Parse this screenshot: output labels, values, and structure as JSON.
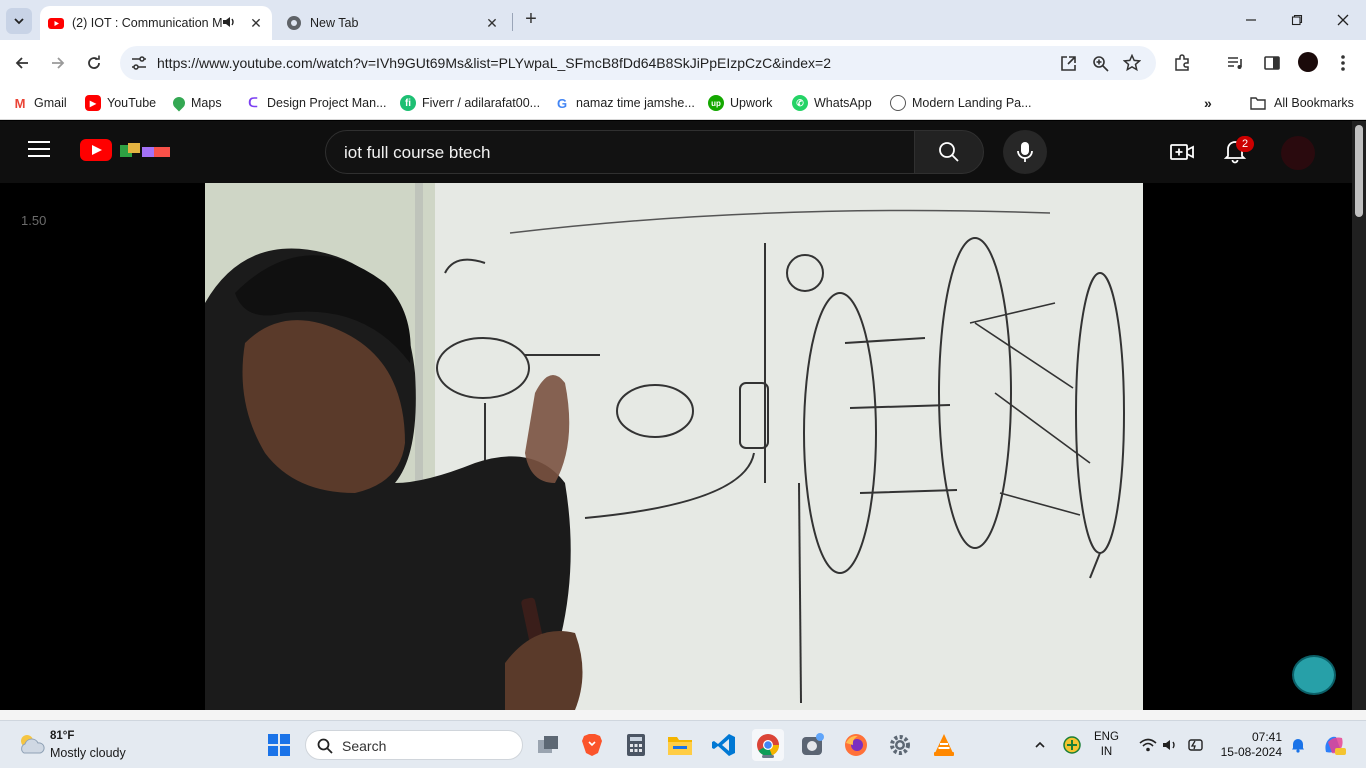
{
  "browser": {
    "tabs": [
      {
        "title": "(2) IOT : Communication Mo",
        "active": true,
        "audio": true
      },
      {
        "title": "New Tab",
        "active": false
      }
    ],
    "url": "https://www.youtube.com/watch?v=IVh9GUt69Ms&list=PLYwpaL_SFmcB8fDd64B8SkJiPpEIzpCzC&index=2",
    "bookmarks": [
      {
        "label": "Gmail",
        "icon": "gmail-icon"
      },
      {
        "label": "YouTube",
        "icon": "youtube-icon"
      },
      {
        "label": "Maps",
        "icon": "maps-icon"
      },
      {
        "label": "Design Project Man...",
        "icon": "design-project-icon"
      },
      {
        "label": "Fiverr / adilarafat00...",
        "icon": "fiverr-icon"
      },
      {
        "label": "namaz time jamshe...",
        "icon": "google-icon"
      },
      {
        "label": "Upwork",
        "icon": "upwork-icon"
      },
      {
        "label": "WhatsApp",
        "icon": "whatsapp-icon"
      },
      {
        "label": "Modern Landing Pa...",
        "icon": "globe-icon"
      }
    ],
    "all_bookmarks_label": "All Bookmarks"
  },
  "youtube": {
    "search_query": "iot full course btech",
    "notifications_count": "2",
    "playback_speed": "1.50"
  },
  "taskbar": {
    "weather_temp": "81°F",
    "weather_desc": "Mostly cloudy",
    "search_label": "Search",
    "language_line1": "ENG",
    "language_line2": "IN",
    "time": "07:41",
    "date": "15-08-2024"
  }
}
